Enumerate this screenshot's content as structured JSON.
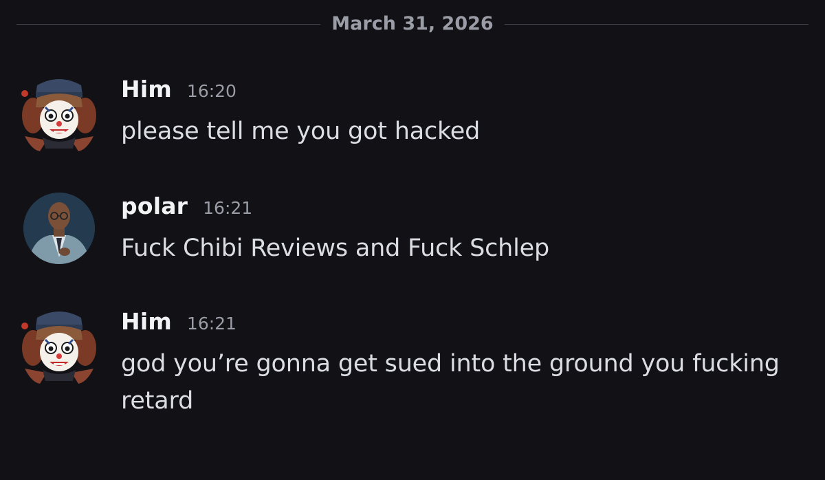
{
  "date_divider": "March 31, 2026",
  "messages": [
    {
      "author": "Him",
      "time": "16:20",
      "text": "please tell me you got hacked",
      "avatar_icon": "clown-chibi-avatar"
    },
    {
      "author": "polar",
      "time": "16:21",
      "text": "Fuck Chibi Reviews and Fuck Schlep",
      "avatar_icon": "man-in-suit-avatar"
    },
    {
      "author": "Him",
      "time": "16:21",
      "text": "god you’re gonna get sued into the ground you fucking retard",
      "avatar_icon": "clown-chibi-avatar"
    }
  ],
  "colors": {
    "background": "#111116",
    "username": "#f2f3f5",
    "timestamp": "#9a9ca6",
    "message_text": "#dcdde3",
    "divider": "#3b3c44"
  }
}
